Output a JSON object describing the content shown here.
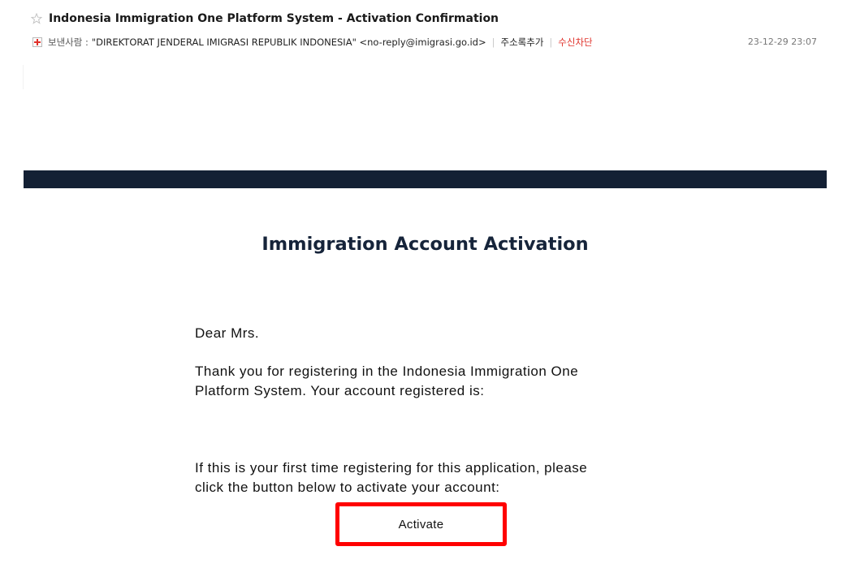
{
  "mail": {
    "subject": "Indonesia Immigration One Platform System - Activation Confirmation",
    "sender_label": "보낸사람 :",
    "sender_value": "\"DIREKTORAT JENDERAL IMIGRASI REPUBLIK INDONESIA\" <no-reply@imigrasi.go.id>",
    "add_contact_label": "주소록추가",
    "block_label": "수신차단",
    "date": "23-12-29 23:07",
    "star_icon": "star-outline-icon",
    "expand_icon": "plus-icon"
  },
  "email": {
    "heading": "Immigration Account Activation",
    "greeting": "Dear Mrs.",
    "thanks_line1": "Thank you for registering in the Indonesia Immigration One",
    "thanks_line2": "Platform System. Your account registered is:",
    "first_time_line1": "If this is your first time registering for this application, please",
    "first_time_line2": "click the button below to activate your account:",
    "activate_label": "Activate"
  },
  "colors": {
    "banner": "#132034",
    "heading": "#16243a",
    "highlight": "#ff0000",
    "block_label": "#e0322b"
  }
}
